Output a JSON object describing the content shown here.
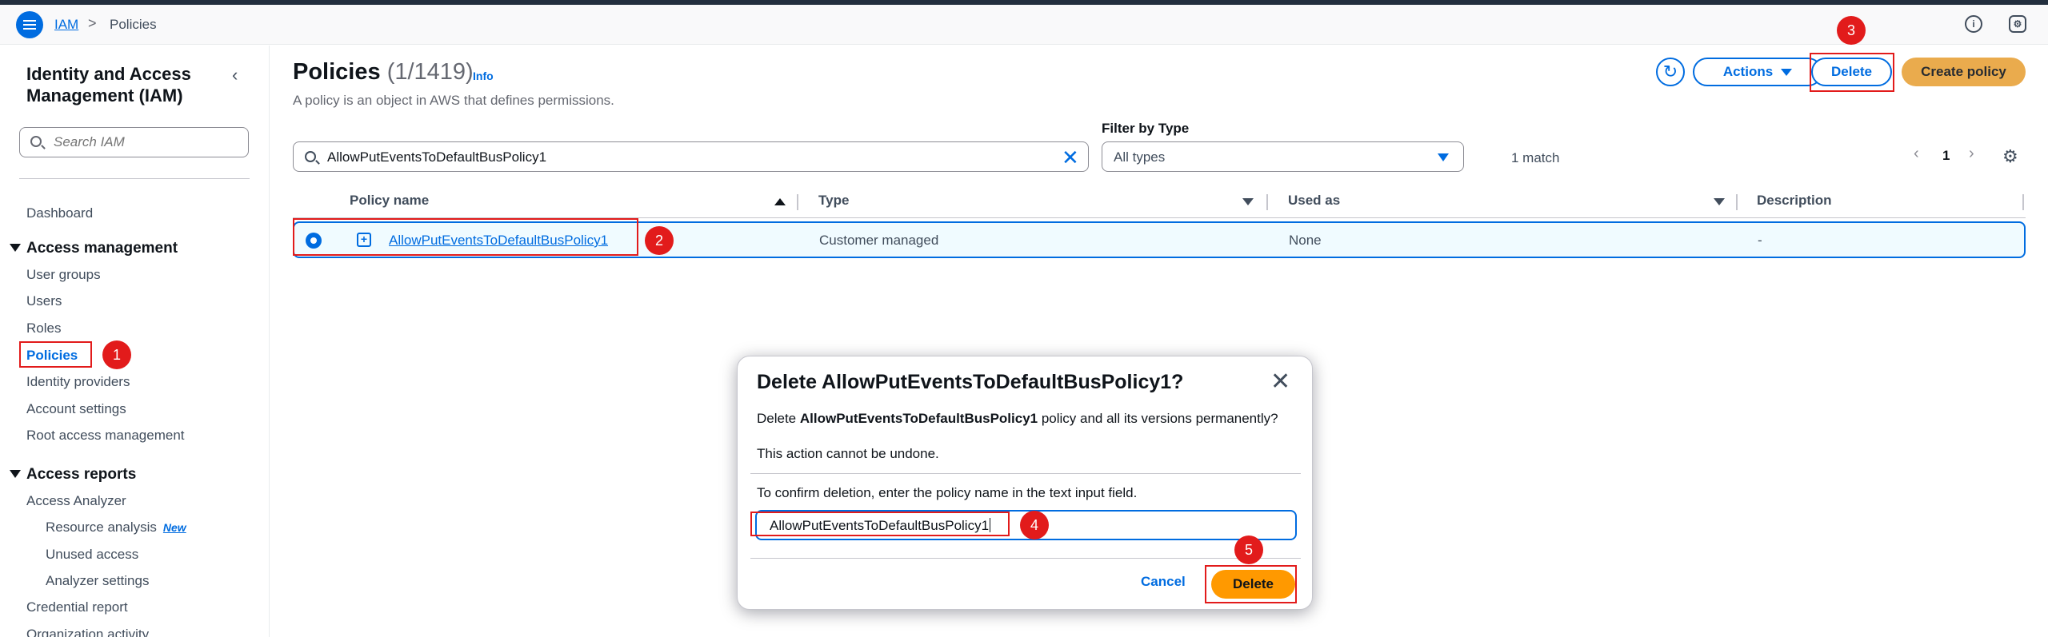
{
  "topbar": {
    "breadcrumb_root": "IAM",
    "breadcrumb_sep": ">",
    "breadcrumb_current": "Policies",
    "info_icon": "i",
    "settings_icon": "⚙"
  },
  "sidebar": {
    "title": "Identity and Access Management (IAM)",
    "search_placeholder": "Search IAM",
    "items": {
      "dashboard": "Dashboard",
      "access_management": "Access management",
      "user_groups": "User groups",
      "users": "Users",
      "roles": "Roles",
      "policies": "Policies",
      "identity_providers": "Identity providers",
      "account_settings": "Account settings",
      "root_access": "Root access management",
      "access_reports": "Access reports",
      "access_analyzer": "Access Analyzer",
      "resource_analysis": "Resource analysis",
      "new_badge": "New",
      "unused_access": "Unused access",
      "analyzer_settings": "Analyzer settings",
      "credential_report": "Credential report",
      "organization_activity": "Organization activity"
    }
  },
  "main": {
    "title": "Policies",
    "count": "(1/1419)",
    "info": "Info",
    "subtitle": "A policy is an object in AWS that defines permissions.",
    "actions_label": "Actions",
    "delete_label": "Delete",
    "create_label": "Create policy",
    "filter_value": "AllowPutEventsToDefaultBusPolicy1",
    "filter_type_label": "Filter by Type",
    "filter_type_value": "All types",
    "match_count": "1 match",
    "page_number": "1",
    "columns": {
      "policy_name": "Policy name",
      "type": "Type",
      "used_as": "Used as",
      "description": "Description"
    },
    "rows": [
      {
        "policy_name": "AllowPutEventsToDefaultBusPolicy1",
        "type": "Customer managed",
        "used_as": "None",
        "description": "-"
      }
    ]
  },
  "modal": {
    "title": "Delete AllowPutEventsToDefaultBusPolicy1?",
    "body_prefix": "Delete ",
    "body_name": "AllowPutEventsToDefaultBusPolicy1",
    "body_suffix": " policy and all its versions permanently?",
    "warning": "This action cannot be undone.",
    "confirm_prompt": "To confirm deletion, enter the policy name in the text input field.",
    "input_value": "AllowPutEventsToDefaultBusPolicy1",
    "cancel_label": "Cancel",
    "delete_label": "Delete"
  },
  "annotations": {
    "step1": "1",
    "step2": "2",
    "step3": "3",
    "step4": "4",
    "step5": "5"
  },
  "colors": {
    "accent": "#006ce0",
    "primary_button": "#ff9900",
    "annotation": "#e21b1b"
  }
}
